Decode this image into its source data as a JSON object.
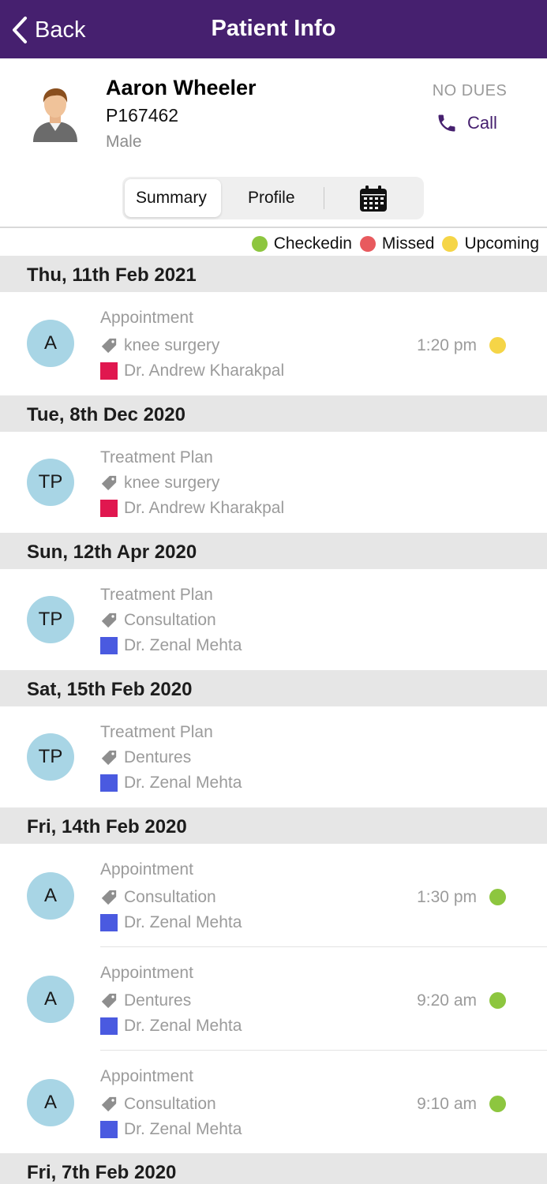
{
  "nav": {
    "back_label": "Back",
    "title": "Patient Info"
  },
  "patient": {
    "name": "Aaron Wheeler",
    "id": "P167462",
    "gender": "Male",
    "dues": "NO DUES",
    "call_label": "Call"
  },
  "tabs": {
    "summary": "Summary",
    "profile": "Profile",
    "calendar_icon": "calendar-icon"
  },
  "legend": [
    {
      "label": "Checkedin",
      "color": "#8dc63f"
    },
    {
      "label": "Missed",
      "color": "#e85a5e"
    },
    {
      "label": "Upcoming",
      "color": "#f5d547"
    }
  ],
  "colors": {
    "accent": "#46206f",
    "avatar_circle": "#a8d5e5",
    "doctor_andrew": "#e0174f",
    "doctor_zenal": "#4a5ae0"
  },
  "dates": [
    "Thu, 11th Feb 2021",
    "Tue, 8th Dec 2020",
    "Sun, 12th Apr 2020",
    "Sat, 15th Feb 2020",
    "Fri, 14th Feb 2020",
    "Fri, 7th Feb 2020"
  ],
  "entries": [
    {
      "initials": "A",
      "type": "Appointment",
      "tag": "knee surgery",
      "doctor": "Dr. Andrew Kharakpal",
      "time": "1:20 pm",
      "status": "Upcoming"
    },
    {
      "initials": "TP",
      "type": "Treatment Plan",
      "tag": "knee surgery",
      "doctor": "Dr. Andrew Kharakpal"
    },
    {
      "initials": "TP",
      "type": "Treatment Plan",
      "tag": "Consultation",
      "doctor": "Dr. Zenal Mehta"
    },
    {
      "initials": "TP",
      "type": "Treatment Plan",
      "tag": "Dentures",
      "doctor": "Dr. Zenal Mehta"
    },
    {
      "initials": "A",
      "type": "Appointment",
      "tag": "Consultation",
      "doctor": "Dr. Zenal Mehta",
      "time": "1:30 pm",
      "status": "Checkedin"
    },
    {
      "initials": "A",
      "type": "Appointment",
      "tag": "Dentures",
      "doctor": "Dr. Zenal Mehta",
      "time": "9:20 am",
      "status": "Checkedin"
    },
    {
      "initials": "A",
      "type": "Appointment",
      "tag": "Consultation",
      "doctor": "Dr. Zenal Mehta",
      "time": "9:10 am",
      "status": "Checkedin"
    }
  ]
}
